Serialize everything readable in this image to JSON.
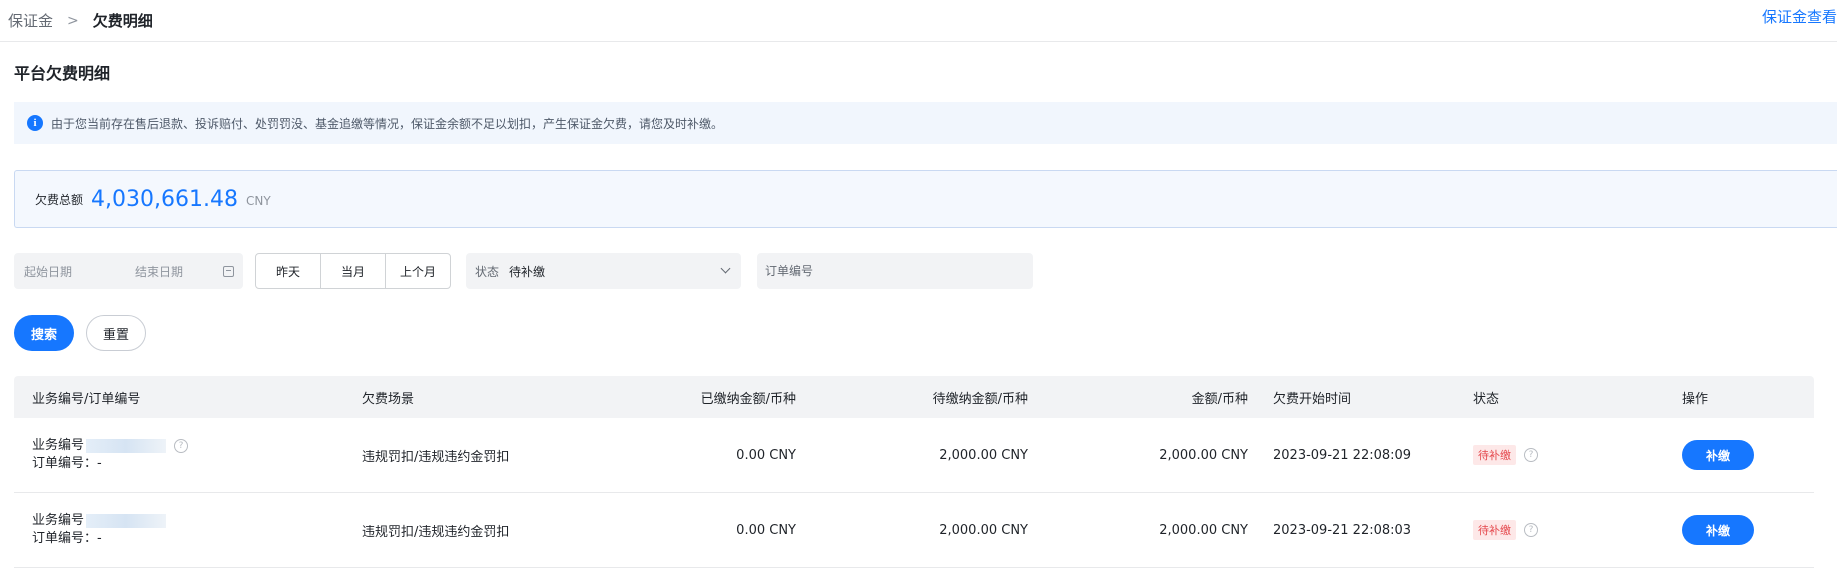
{
  "breadcrumb": {
    "parent": "保证金",
    "separator": ">",
    "current": "欠费明细"
  },
  "top_right_link": "保证金查看",
  "page_title": "平台欠费明细",
  "notice": {
    "icon": "info-icon",
    "text": "由于您当前存在售后退款、投诉赔付、处罚罚没、基金追缴等情况，保证金余额不足以划扣，产生保证金欠费，请您及时补缴。"
  },
  "summary": {
    "label": "欠费总额",
    "amount": "4,030,661.48",
    "unit": "CNY"
  },
  "filters": {
    "date_start_placeholder": "起始日期",
    "date_end_placeholder": "结束日期",
    "quick_dates": [
      "昨天",
      "当月",
      "上个月"
    ],
    "status_label": "状态",
    "status_value": "待补缴",
    "order_placeholder": "订单编号"
  },
  "actions": {
    "search": "搜索",
    "reset": "重置"
  },
  "table": {
    "columns": [
      "业务编号/订单编号",
      "欠费场景",
      "已缴纳金额/币种",
      "待缴纳金额/币种",
      "金额/币种",
      "欠费开始时间",
      "状态",
      "操作"
    ],
    "rows": [
      {
        "biz_label": "业务编号",
        "order_label": "订单编号：-",
        "scene": "违规罚扣/违规违约金罚扣",
        "paid": "0.00 CNY",
        "pending": "2,000.00 CNY",
        "amount": "2,000.00 CNY",
        "start_time": "2023-09-21 22:08:09",
        "status": "待补缴",
        "action": "补缴"
      },
      {
        "biz_label": "业务编号",
        "order_label": "订单编号：-",
        "scene": "违规罚扣/违规违约金罚扣",
        "paid": "0.00 CNY",
        "pending": "2,000.00 CNY",
        "amount": "2,000.00 CNY",
        "start_time": "2023-09-21 22:08:03",
        "status": "待补缴",
        "action": "补缴"
      }
    ]
  },
  "colors": {
    "accent": "#1677ff",
    "status_red": "#e5484d",
    "status_bg": "#fde8e8"
  }
}
